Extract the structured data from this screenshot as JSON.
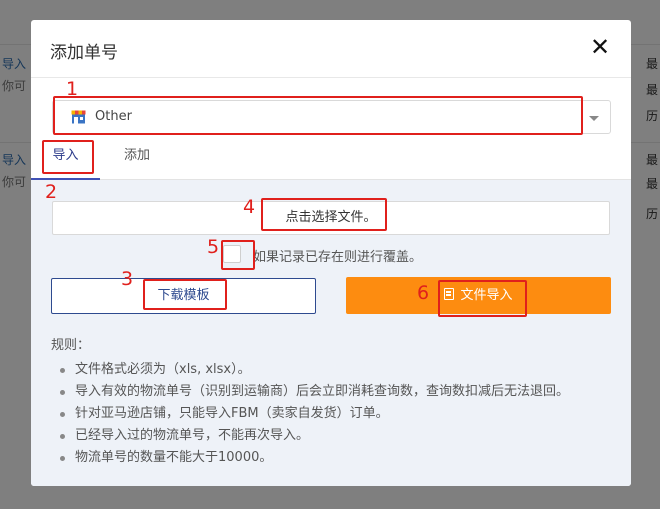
{
  "background": {
    "rows": [
      {
        "title": "导入",
        "sub": "你可",
        "right1": "最",
        "right2": "最",
        "right3": "历"
      },
      {
        "title": "导入",
        "sub": "你可",
        "right1": "最",
        "right2": "最",
        "right3": "历"
      }
    ]
  },
  "modal": {
    "title": "添加单号",
    "close_icon": "close-x-icon",
    "carrier_select": {
      "value": "Other",
      "icon": "store-icon"
    },
    "tabs": [
      {
        "label": "导入",
        "active": true
      },
      {
        "label": "添加",
        "active": false
      }
    ],
    "import": {
      "file_picker_label": "点击选择文件。",
      "overwrite_label": "如果记录已存在则进行覆盖。",
      "download_template_label": "下载模板",
      "import_button_label": "文件导入",
      "import_button_icon": "clipboard-icon",
      "rules_title": "规则：",
      "rules": [
        "文件格式必须为（xls, xlsx）。",
        "导入有效的物流单号（识别到运输商）后会立即消耗查询数，查询数扣减后无法退回。",
        "针对亚马逊店铺，只能导入FBM（卖家自发货）订单。",
        "已经导入过的物流单号，不能再次导入。",
        "物流单号的数量不能大于10000。"
      ]
    }
  },
  "colors": {
    "accent_orange": "#fd8c10",
    "primary_blue": "#2e4a8f",
    "annotation_red": "#e0201c"
  },
  "annotations": [
    "1",
    "2",
    "3",
    "4",
    "5",
    "6"
  ]
}
